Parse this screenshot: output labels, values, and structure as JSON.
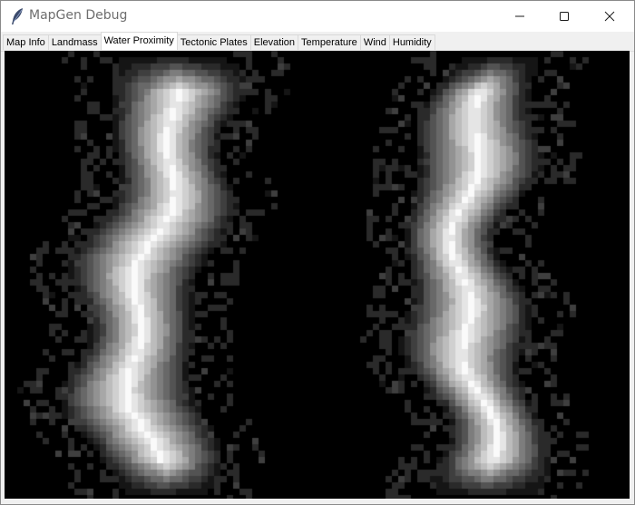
{
  "window": {
    "title": "MapGen Debug",
    "app_icon": "feather-icon",
    "controls": [
      "minimize-icon",
      "maximize-icon",
      "close-icon"
    ]
  },
  "tabs": [
    {
      "label": "Map Info",
      "active": false
    },
    {
      "label": "Landmass",
      "active": false
    },
    {
      "label": "Water Proximity",
      "active": true
    },
    {
      "label": "Tectonic Plates",
      "active": false
    },
    {
      "label": "Elevation",
      "active": false
    },
    {
      "label": "Temperature",
      "active": false
    },
    {
      "label": "Wind",
      "active": false
    },
    {
      "label": "Humidity",
      "active": false
    }
  ],
  "colors": {
    "canvas_background": "#000000",
    "cell_max": "#ffffff",
    "title_text": "#6e6e6e"
  }
}
